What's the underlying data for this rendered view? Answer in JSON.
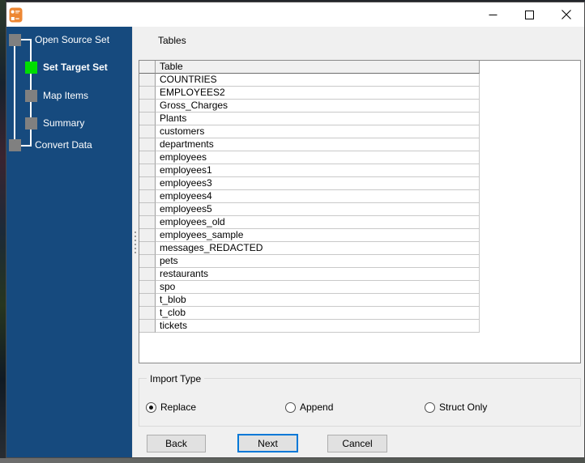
{
  "window": {
    "title": "",
    "controls": {
      "minimize": "minimize",
      "maximize": "maximize",
      "close": "close"
    }
  },
  "sidebar": {
    "colors": {
      "background": "#164A7E",
      "active_square": "#00DE00",
      "inactive_square": "#808080"
    },
    "steps": [
      {
        "label": "Open Source Set",
        "level": 0,
        "active": false
      },
      {
        "label": "Set Target Set",
        "level": 1,
        "active": true
      },
      {
        "label": "Map Items",
        "level": 1,
        "active": false
      },
      {
        "label": "Summary",
        "level": 1,
        "active": false
      },
      {
        "label": "Convert Data",
        "level": 0,
        "active": false
      }
    ]
  },
  "content": {
    "section_label": "Tables",
    "grid": {
      "header": "Table",
      "rows": [
        "COUNTRIES",
        "EMPLOYEES2",
        "Gross_Charges",
        "Plants",
        "customers",
        "departments",
        "employees",
        "employees1",
        "employees3",
        "employees4",
        "employees5",
        "employees_old",
        "employees_sample",
        "messages_REDACTED",
        "pets",
        "restaurants",
        "spo",
        "t_blob",
        "t_clob",
        "tickets"
      ]
    },
    "import_type": {
      "label": "Import Type",
      "options": [
        {
          "label": "Replace",
          "selected": true
        },
        {
          "label": "Append",
          "selected": false
        },
        {
          "label": "Struct Only",
          "selected": false
        }
      ]
    },
    "buttons": {
      "back": "Back",
      "next": "Next",
      "cancel": "Cancel"
    },
    "accent_color": "#0078D7"
  }
}
